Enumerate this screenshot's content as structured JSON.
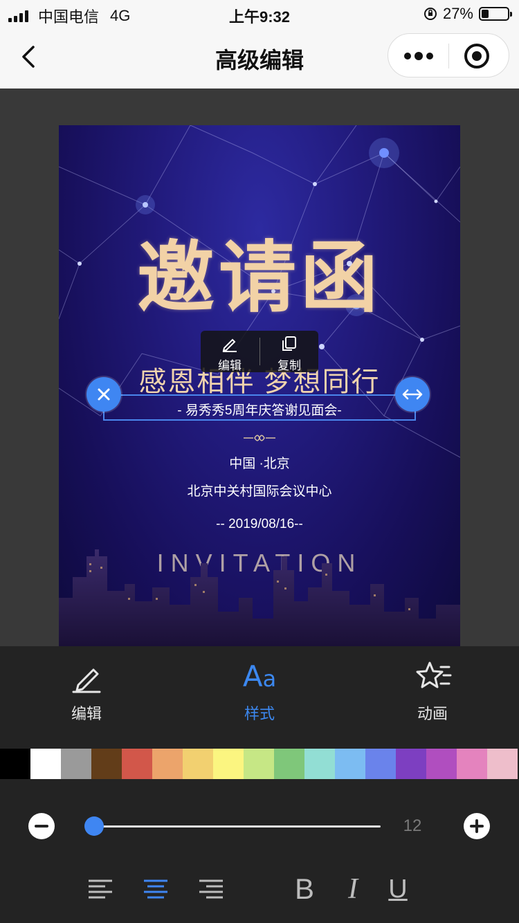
{
  "status_bar": {
    "carrier": "中国电信",
    "network": "4G",
    "time": "上午9:32",
    "battery": "27%",
    "battery_level": 0.27
  },
  "nav": {
    "title": "高级编辑",
    "back_icon": "chevron-left-icon",
    "more_icon": "more-dots-icon",
    "close_icon": "target-circle-icon"
  },
  "card": {
    "title": "邀请函",
    "subtitle": "感恩相伴 梦想同行",
    "event": "- 易秀秀5周年庆答谢见面会-",
    "city": "中国 ·北京",
    "venue": "北京中关村国际会议中心",
    "date": "-- 2019/08/16--",
    "invitation": "INVITATION"
  },
  "popup": {
    "edit_label": "编辑",
    "copy_label": "复制"
  },
  "tabs": [
    {
      "label": "编辑",
      "icon": "pencil-icon",
      "active": false
    },
    {
      "label": "样式",
      "icon": "font-style-icon",
      "active": true
    },
    {
      "label": "动画",
      "icon": "star-animation-icon",
      "active": false
    }
  ],
  "style_tab_glyph": {
    "big": "A",
    "small": "a"
  },
  "palette": [
    "#000000",
    "#ffffff",
    "#9a9a9a",
    "#623d19",
    "#d2574a",
    "#eca46b",
    "#f2d070",
    "#fbf580",
    "#c6e785",
    "#7fc77a",
    "#92ded4",
    "#7cbcf2",
    "#6a83eb",
    "#7d3fc1",
    "#b04ebf",
    "#e483be",
    "#eebecb"
  ],
  "font_size": {
    "value": "12",
    "slider_fraction": 0.0
  },
  "format": {
    "bold": "B",
    "italic": "I",
    "underline": "U",
    "alignment": "center"
  },
  "colors": {
    "accent": "#3f86f2",
    "title_gold": "#f2d2a6"
  }
}
